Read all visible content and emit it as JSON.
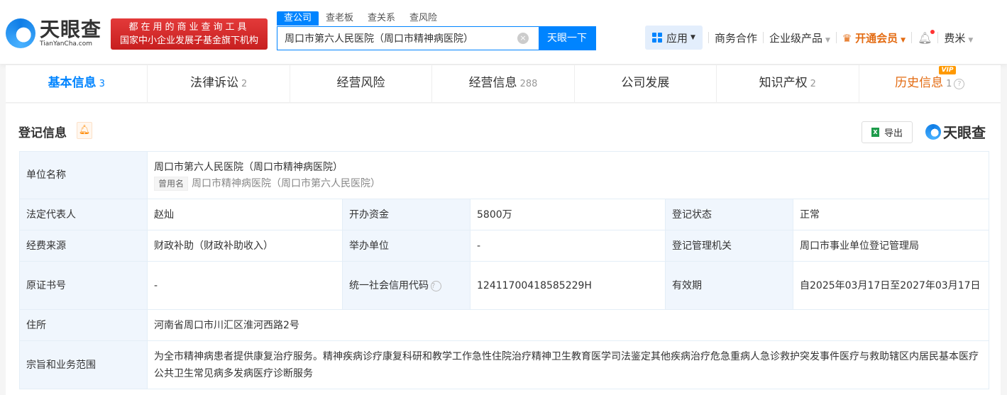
{
  "header": {
    "logo_cn": "天眼查",
    "logo_en": "TianYanCha.com",
    "slogan_line1": "都在用的商业查询工具",
    "slogan_line2": "国家中小企业发展子基金旗下机构",
    "search_tabs": [
      "查公司",
      "查老板",
      "查关系",
      "查风险"
    ],
    "search_value": "周口市第六人民医院（周口市精神病医院）",
    "clear_icon": "×",
    "search_button": "天眼一下",
    "nav": {
      "apps": "应用",
      "business": "商务合作",
      "enterprise": "企业级产品",
      "vip": "开通会员",
      "user": "费米"
    }
  },
  "tabs": [
    {
      "label": "基本信息",
      "count": "3"
    },
    {
      "label": "法律诉讼",
      "count": "2"
    },
    {
      "label": "经营风险",
      "count": ""
    },
    {
      "label": "经营信息",
      "count": "288"
    },
    {
      "label": "公司发展",
      "count": ""
    },
    {
      "label": "知识产权",
      "count": "2"
    },
    {
      "label": "历史信息",
      "count": "1",
      "badge": "VIP"
    }
  ],
  "section": {
    "title": "登记信息",
    "export": "导出",
    "brand": "天眼查"
  },
  "info": {
    "name_label": "单位名称",
    "name": "周口市第六人民医院（周口市精神病医院）",
    "used_tag": "曾用名",
    "used_name": "周口市精神病医院（周口市第六人民医院）",
    "rep_label": "法定代表人",
    "rep": "赵灿",
    "capital_label": "开办资金",
    "capital": "5800万",
    "status_label": "登记状态",
    "status": "正常",
    "fund_label": "经费来源",
    "fund": "财政补助（财政补助收入）",
    "sponsor_label": "举办单位",
    "sponsor": "-",
    "authority_label": "登记管理机关",
    "authority": "周口市事业单位登记管理局",
    "cert_label": "原证书号",
    "cert": "-",
    "credit_label": "统一社会信用代码",
    "credit": "12411700418585229H",
    "valid_label": "有效期",
    "valid": "自2025年03月17日至2027年03月17日",
    "address_label": "住所",
    "address": "河南省周口市川汇区淮河西路2号",
    "scope_label": "宗旨和业务范围",
    "scope": "为全市精神病患者提供康复治疗服务。精神疾病诊疗康复科研和教学工作急性住院治疗精神卫生教育医学司法鉴定其他疾病治疗危急重病人急诊救护突发事件医疗与救助辖区内居民基本医疗公共卫生常见病多发病医疗诊断服务"
  }
}
